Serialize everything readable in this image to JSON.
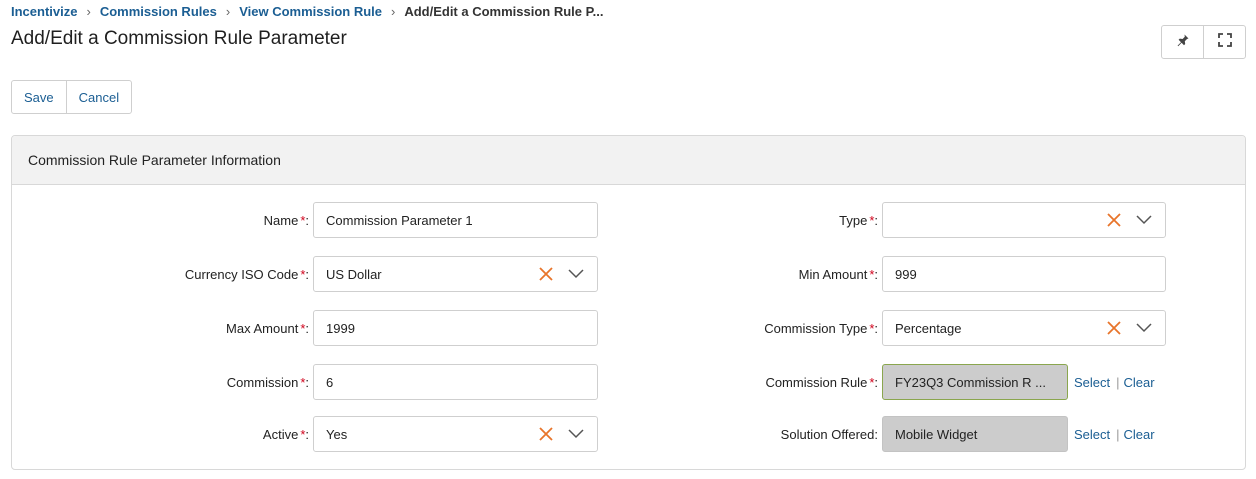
{
  "breadcrumb": {
    "items": [
      "Incentivize",
      "Commission Rules",
      "View Commission Rule"
    ],
    "current": "Add/Edit a Commission Rule P..."
  },
  "page": {
    "title": "Add/Edit a Commission Rule Parameter"
  },
  "toolbar": {
    "save_label": "Save",
    "cancel_label": "Cancel"
  },
  "header_tools": {
    "pin_icon": "pin-icon",
    "fullscreen_icon": "fullscreen-icon"
  },
  "panel": {
    "title": "Commission Rule Parameter Information"
  },
  "form": {
    "name": {
      "label": "Name",
      "required": "*",
      "value": "Commission Parameter 1"
    },
    "currency": {
      "label": "Currency ISO Code",
      "required": "*",
      "value": "US Dollar"
    },
    "max_amount": {
      "label": "Max Amount",
      "required": "*",
      "value": "1999"
    },
    "commission": {
      "label": "Commission",
      "required": "*",
      "value": "6"
    },
    "active": {
      "label": "Active",
      "required": "*",
      "value": "Yes"
    },
    "type": {
      "label": "Type",
      "required": "*",
      "value": ""
    },
    "min_amount": {
      "label": "Min Amount",
      "required": "*",
      "value": "999"
    },
    "commission_type": {
      "label": "Commission Type",
      "required": "*",
      "value": "Percentage"
    },
    "commission_rule": {
      "label": "Commission Rule",
      "required": "*",
      "value": "FY23Q3 Commission R ...",
      "select": "Select",
      "divider": "|",
      "clear": "Clear"
    },
    "solution_offered": {
      "label": "Solution Offered:",
      "value": "Mobile Widget",
      "select": "Select",
      "divider": "|",
      "clear": "Clear"
    }
  },
  "colors": {
    "link": "#1b5e93",
    "required": "#d0021b",
    "clear_x": "#e8742a",
    "readonly_bg": "#cccccc"
  }
}
